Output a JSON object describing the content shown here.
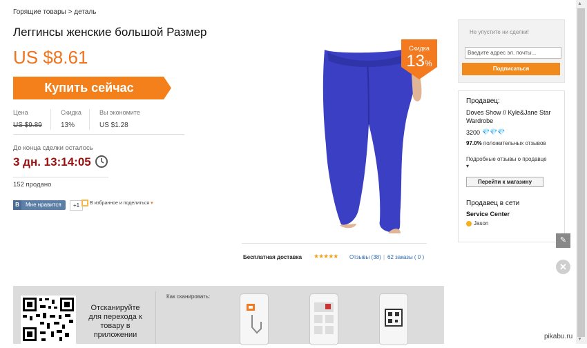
{
  "breadcrumb": "Горящие товары > деталь",
  "product": {
    "title": "Леггинсы женские большой Размер",
    "price": "US $8.61",
    "buy_label": "Купить сейчас",
    "discount_badge": {
      "label": "Скидка",
      "value": "13",
      "unit": "%"
    }
  },
  "stats": {
    "price_label": "Цена",
    "price_value": "US $9.89",
    "discount_label": "Скидка",
    "discount_value": "13%",
    "save_label": "Вы экономите",
    "save_value": "US $1.28"
  },
  "deal": {
    "label": "До конца сделки осталось",
    "timer": "3 дн. 13:14:05",
    "sold": "152 продано"
  },
  "social": {
    "vk_badge": "В",
    "vk_label": "Мне нравится",
    "gplus": "+1",
    "favorite": "В избранное и поделиться"
  },
  "product_footer": {
    "shipping": "Бесплатная доставка",
    "rating_stars": "★★★★★",
    "reviews": "Отзывы (38)",
    "separator": "|",
    "orders": "62 заказы ( 0 )"
  },
  "promo": {
    "text": "Не упустите ни сделки!",
    "email_placeholder": "Введите адрес эл. почты...",
    "subscribe": "Подписаться"
  },
  "seller": {
    "heading": "Продавец:",
    "name": "Doves Show // Kyle&Jane Star Wardrobe",
    "score": "3200",
    "diamonds": "💎💎💎",
    "positive_pct": "97.0%",
    "positive_label": "положительных отзывов",
    "details": "Подробные отзывы о продавце",
    "store_button": "Перейти к магазину"
  },
  "online": {
    "heading": "Продавец в сети",
    "center": "Service Center",
    "user": "Jason"
  },
  "qr": {
    "text": "Отсканируйте для перехода к товару в приложении",
    "how_label": "Как сканировать:"
  },
  "controls": {
    "edit_icon": "✎",
    "close_icon": "✕",
    "scroll_up": "▲",
    "scroll_down": "▼"
  },
  "watermark": "pikabu.ru",
  "colors": {
    "accent": "#f0731e",
    "buy_button": "#f4801c",
    "timer": "#9b1111",
    "link": "#2a6ab2",
    "leggings": "#3a3fc4"
  }
}
